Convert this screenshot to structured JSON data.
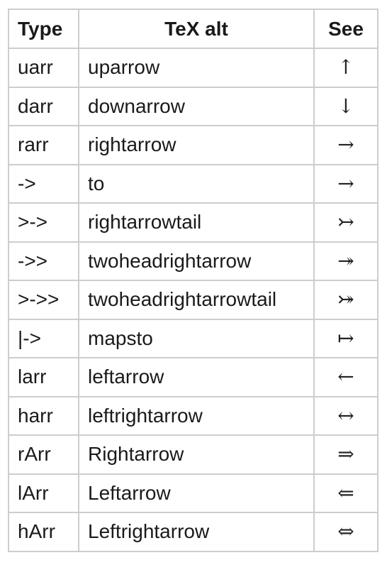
{
  "table": {
    "headers": {
      "type": "Type",
      "tex_alt": "TeX alt",
      "see": "See"
    },
    "rows": [
      {
        "type": "uarr",
        "tex_alt": "uparrow",
        "see": "↑"
      },
      {
        "type": "darr",
        "tex_alt": "downarrow",
        "see": "↓"
      },
      {
        "type": "rarr",
        "tex_alt": "rightarrow",
        "see": "→"
      },
      {
        "type": "->",
        "tex_alt": "to",
        "see": "→"
      },
      {
        "type": ">->",
        "tex_alt": "rightarrowtail",
        "see": "↣"
      },
      {
        "type": "->>",
        "tex_alt": "twoheadrightarrow",
        "see": "↠"
      },
      {
        "type": ">->>",
        "tex_alt": "twoheadrightarrowtail",
        "see": "⤖"
      },
      {
        "type": "|->",
        "tex_alt": "mapsto",
        "see": "↦"
      },
      {
        "type": "larr",
        "tex_alt": "leftarrow",
        "see": "←"
      },
      {
        "type": "harr",
        "tex_alt": "leftrightarrow",
        "see": "↔"
      },
      {
        "type": "rArr",
        "tex_alt": "Rightarrow",
        "see": "⇒"
      },
      {
        "type": "lArr",
        "tex_alt": "Leftarrow",
        "see": "⇐"
      },
      {
        "type": "hArr",
        "tex_alt": "Leftrightarrow",
        "see": "⇔"
      }
    ]
  }
}
